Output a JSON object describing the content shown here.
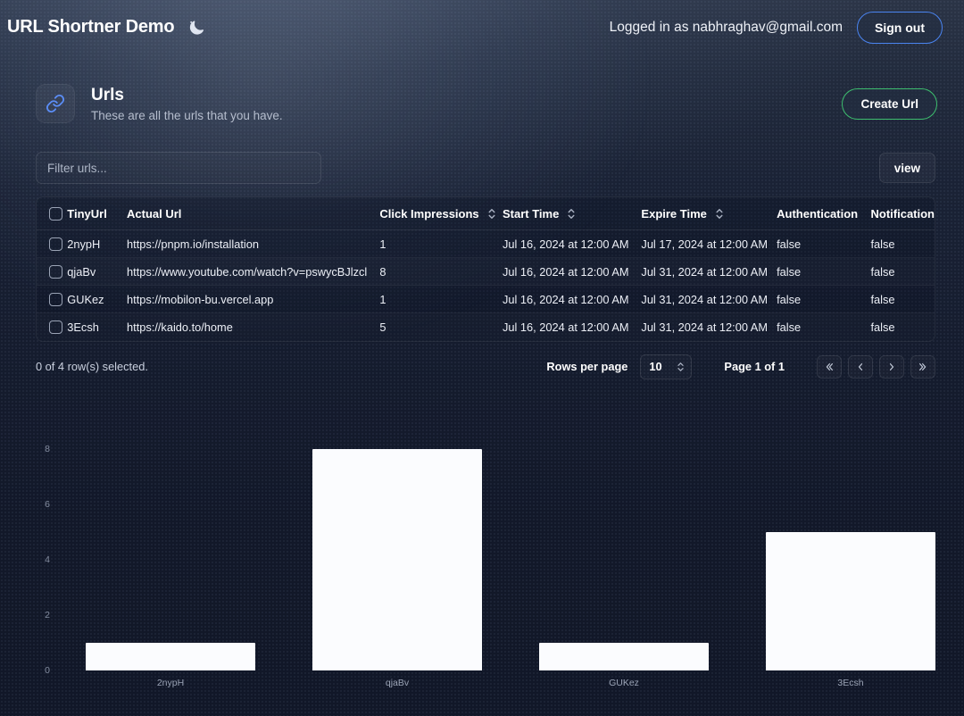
{
  "header": {
    "brand_title": "URL Shortner Demo",
    "theme_icon": "moon-stars-icon",
    "logged_in_text": "Logged in as nabhraghav@gmail.com",
    "signout_label": "Sign out",
    "signout_border_color": "#4a84f0"
  },
  "section": {
    "icon": "link-icon",
    "title": "Urls",
    "subtitle": "These are all the urls that you have.",
    "create_label": "Create Url",
    "create_border_color": "#3dbd6e"
  },
  "toolbar": {
    "filter_placeholder": "Filter urls...",
    "filter_value": "",
    "view_label": "view"
  },
  "table": {
    "columns": [
      {
        "key": "select",
        "label": "",
        "sortable": false
      },
      {
        "key": "tiny",
        "label": "TinyUrl",
        "sortable": false
      },
      {
        "key": "actual",
        "label": "Actual Url",
        "sortable": false
      },
      {
        "key": "clicks",
        "label": "Click Impressions",
        "sortable": true
      },
      {
        "key": "start",
        "label": "Start Time",
        "sortable": true
      },
      {
        "key": "expire",
        "label": "Expire Time",
        "sortable": true
      },
      {
        "key": "auth",
        "label": "Authentication",
        "sortable": false
      },
      {
        "key": "notif",
        "label": "Notification",
        "sortable": false
      }
    ],
    "rows": [
      {
        "tiny": "2nypH",
        "actual": "https://pnpm.io/installation",
        "clicks": "1",
        "start": "Jul 16, 2024 at 12:00 AM",
        "expire": "Jul 17, 2024 at 12:00 AM",
        "auth": "false",
        "notif": "false",
        "selected": false
      },
      {
        "tiny": "qjaBv",
        "actual": "https://www.youtube.com/watch?v=pswycBJlzcl",
        "clicks": "8",
        "start": "Jul 16, 2024 at 12:00 AM",
        "expire": "Jul 31, 2024 at 12:00 AM",
        "auth": "false",
        "notif": "false",
        "selected": false
      },
      {
        "tiny": "GUKez",
        "actual": "https://mobilon-bu.vercel.app",
        "clicks": "1",
        "start": "Jul 16, 2024 at 12:00 AM",
        "expire": "Jul 31, 2024 at 12:00 AM",
        "auth": "false",
        "notif": "false",
        "selected": false
      },
      {
        "tiny": "3Ecsh",
        "actual": "https://kaido.to/home",
        "clicks": "5",
        "start": "Jul 16, 2024 at 12:00 AM",
        "expire": "Jul 31, 2024 at 12:00 AM",
        "auth": "false",
        "notif": "false",
        "selected": false
      }
    ]
  },
  "footer": {
    "selection_text": "0 of 4 row(s) selected.",
    "rows_per_page_label": "Rows per page",
    "rows_per_page_value": "10",
    "page_text": "Page 1 of 1",
    "first_page_icon": "chevron-double-left-icon",
    "prev_page_icon": "chevron-left-icon",
    "next_page_icon": "chevron-right-icon",
    "last_page_icon": "chevron-double-right-icon"
  },
  "chart_data": {
    "type": "bar",
    "title": "",
    "xlabel": "",
    "ylabel": "",
    "categories": [
      "2nypH",
      "qjaBv",
      "GUKez",
      "3Ecsh"
    ],
    "values": [
      1,
      8,
      1,
      5
    ],
    "series": [
      {
        "name": "Click Impressions",
        "values": [
          1,
          8,
          1,
          5
        ]
      }
    ],
    "ylim": [
      0,
      8.6
    ],
    "yticks": [
      0,
      2,
      4,
      6,
      8
    ],
    "grid": false,
    "legend": "none",
    "bar_color": "#fbfcfe"
  }
}
